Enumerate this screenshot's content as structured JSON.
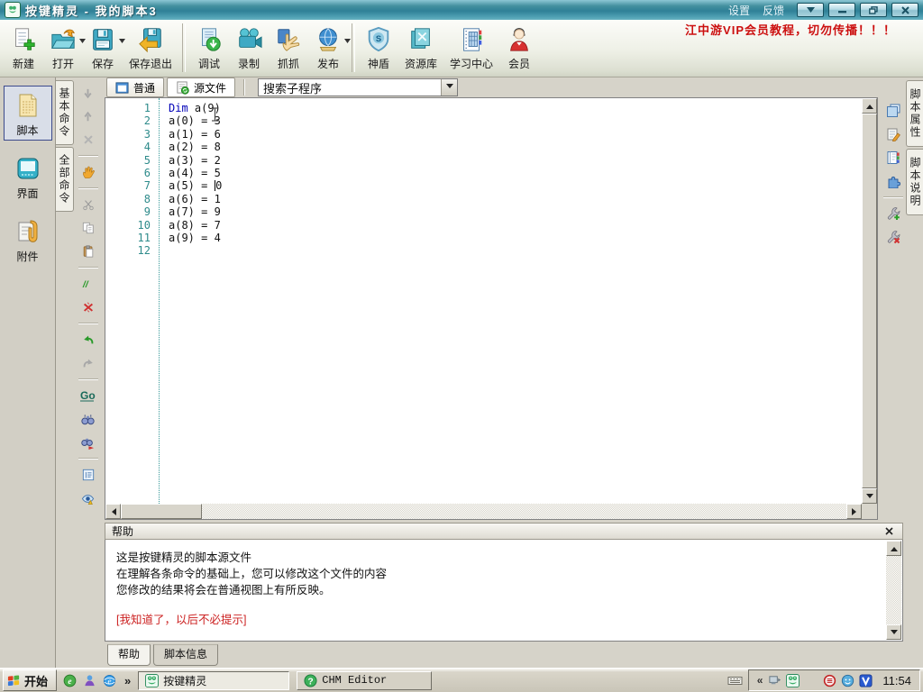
{
  "colors": {
    "titlebar": "#3e8da2",
    "banner_red": "#cc1010",
    "keyword_blue": "#0000b8",
    "line_number_teal": "#2e8b8b",
    "link_red": "#cc2222"
  },
  "window": {
    "title": "按键精灵 - 我的脚本3",
    "settings_label": "设置",
    "feedback_label": "反馈"
  },
  "banner": {
    "text": "江中游VIP会员教程，切勿传播！！！"
  },
  "toolbar": {
    "items": [
      {
        "name": "new",
        "label": "新建",
        "icon": "new"
      },
      {
        "name": "open",
        "label": "打开",
        "icon": "open",
        "dropdown": true
      },
      {
        "name": "save",
        "label": "保存",
        "icon": "save",
        "dropdown": true
      },
      {
        "name": "save-exit",
        "label": "保存退出",
        "icon": "save-exit",
        "sep_after": true
      },
      {
        "name": "debug",
        "label": "调试",
        "icon": "debug"
      },
      {
        "name": "record",
        "label": "录制",
        "icon": "record"
      },
      {
        "name": "grab",
        "label": "抓抓",
        "icon": "grab"
      },
      {
        "name": "publish",
        "label": "发布",
        "icon": "publish",
        "dropdown": true,
        "sep_after": true
      },
      {
        "name": "shield",
        "label": "神盾",
        "icon": "shield"
      },
      {
        "name": "resource",
        "label": "资源库",
        "icon": "resource"
      },
      {
        "name": "learn-center",
        "label": "学习中心",
        "icon": "learn"
      },
      {
        "name": "member",
        "label": "会员",
        "icon": "member"
      }
    ]
  },
  "sidebar": {
    "items": [
      {
        "name": "script",
        "label": "脚本",
        "icon": "script",
        "active": true
      },
      {
        "name": "interface",
        "label": "界面",
        "icon": "ui"
      },
      {
        "name": "attachment",
        "label": "附件",
        "icon": "attach"
      }
    ]
  },
  "command_tabs": [
    {
      "name": "basic-commands",
      "label": "基本命令"
    },
    {
      "name": "all-commands",
      "label": "全部命令"
    }
  ],
  "edit_icons": [
    {
      "name": "move-down",
      "icon": "down"
    },
    {
      "name": "move-up",
      "icon": "up"
    },
    {
      "name": "delete-line",
      "icon": "del"
    },
    {
      "sep": true
    },
    {
      "name": "drag-hand",
      "icon": "hand"
    },
    {
      "sep": true
    },
    {
      "name": "cut",
      "icon": "cut"
    },
    {
      "name": "copy",
      "icon": "copy"
    },
    {
      "name": "paste",
      "icon": "paste"
    },
    {
      "sep": true
    },
    {
      "name": "comment",
      "icon": "comment"
    },
    {
      "name": "uncomment",
      "icon": "uncomment"
    },
    {
      "sep": true
    },
    {
      "name": "undo",
      "icon": "undo"
    },
    {
      "name": "redo",
      "icon": "redo"
    },
    {
      "sep": true
    },
    {
      "name": "goto-line",
      "icon": "go"
    },
    {
      "name": "find",
      "icon": "find"
    },
    {
      "name": "find-next",
      "icon": "findnext"
    },
    {
      "sep": true
    },
    {
      "name": "command-list",
      "icon": "list"
    },
    {
      "name": "preview",
      "icon": "eye"
    }
  ],
  "view_tabs": [
    {
      "name": "normal",
      "label": "普通",
      "icon": "tab-normal"
    },
    {
      "name": "source",
      "label": "源文件",
      "icon": "tab-source",
      "active": true
    }
  ],
  "search": {
    "value": "搜索子程序"
  },
  "code": {
    "caret_line": 7,
    "lines": [
      "Dim a(9)",
      "a(0) = 3",
      "a(1) = 6",
      "a(2) = 8",
      "a(3) = 2",
      "a(4) = 5",
      "a(5) = 0",
      "a(6) = 1",
      "a(7) = 9",
      "a(8) = 7",
      "a(9) = 4",
      ""
    ]
  },
  "right_icons": [
    {
      "name": "script-properties",
      "icon": "note"
    },
    {
      "name": "script-notes",
      "icon": "edit"
    },
    {
      "name": "resource-book",
      "icon": "book"
    },
    {
      "name": "plugin",
      "icon": "puzzle"
    },
    {
      "sep": true
    },
    {
      "name": "add-tool",
      "icon": "wrench-add"
    },
    {
      "name": "remove-tool",
      "icon": "wrench-del"
    }
  ],
  "right_tabs": [
    {
      "name": "script-properties",
      "label": "脚本属性"
    },
    {
      "name": "script-description",
      "label": "脚本说明"
    }
  ],
  "help": {
    "title": "帮助",
    "lines": [
      "这是按键精灵的脚本源文件",
      "在理解各条命令的基础上，您可以修改这个文件的内容",
      "您修改的结果将会在普通视图上有所反映。"
    ],
    "link": "[我知道了，以后不必提示]",
    "tabs": [
      {
        "name": "help",
        "label": "帮助",
        "active": true
      },
      {
        "name": "script-info",
        "label": "脚本信息"
      }
    ]
  },
  "taskbar": {
    "start_label": "开始",
    "quick_launch": [
      {
        "name": "green-e",
        "icon": "greene"
      },
      {
        "name": "messenger",
        "icon": "msn"
      },
      {
        "name": "internet-explorer",
        "icon": "ie"
      }
    ],
    "overflow_chevron": "»",
    "tasks": [
      {
        "name": "quickmacro",
        "label": "按键精灵",
        "icon": "frog",
        "active": true
      },
      {
        "name": "chm-editor",
        "label": "CHM Editor",
        "icon": "chm",
        "mono": true
      }
    ],
    "tray_collapse": "«",
    "tray_icons": [
      {
        "name": "device",
        "icon": "device"
      },
      {
        "name": "quickmacro-tray",
        "icon": "frog"
      }
    ],
    "tray_icons2": [
      {
        "name": "red-app",
        "icon": "redapp"
      },
      {
        "name": "blue-app",
        "icon": "blueapp"
      },
      {
        "name": "v-app",
        "icon": "vapp"
      }
    ],
    "time": "11:54"
  }
}
